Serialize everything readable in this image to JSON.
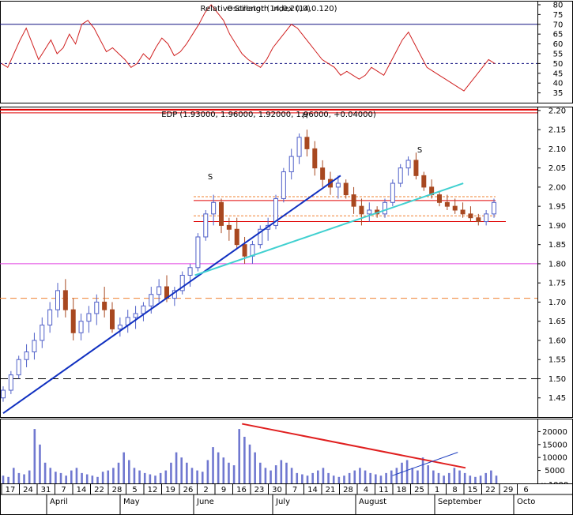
{
  "chart_data": [
    {
      "type": "line",
      "title": "Relative Strength Index (14,0.120)",
      "overlay_title": "Oscillator (14,0,20,0)",
      "yticks": [
        "80",
        "75",
        "70",
        "65",
        "60",
        "55",
        "50",
        "45",
        "40",
        "35"
      ],
      "ylim": [
        30,
        82
      ],
      "reference_lines": [
        70,
        50
      ],
      "series": [
        {
          "values": [
            50,
            48,
            55,
            62,
            68,
            60,
            52,
            57,
            62,
            55,
            58,
            65,
            60,
            70,
            72,
            68,
            62,
            56,
            58,
            55,
            52,
            48,
            50,
            55,
            52,
            58,
            63,
            60,
            54,
            56,
            60,
            65,
            70,
            76,
            80,
            76,
            72,
            65,
            60,
            55,
            52,
            50,
            48,
            52,
            58,
            62,
            66,
            70,
            68,
            64,
            60,
            56,
            52,
            50,
            48,
            44,
            46,
            44,
            42,
            44,
            48,
            46,
            44,
            50,
            56,
            62,
            66,
            60,
            54,
            48,
            46,
            44,
            42,
            40,
            38,
            36,
            40,
            44,
            48,
            52,
            50
          ]
        }
      ]
    },
    {
      "type": "bar",
      "title": "EDP (1.93000, 1.96000, 1.92000, 1.96000, +0.04000)",
      "yticks": [
        "2.20",
        "2.15",
        "2.10",
        "2.05",
        "2.00",
        "1.95",
        "1.90",
        "1.85",
        "1.80",
        "1.75",
        "1.70",
        "1.65",
        "1.60",
        "1.55",
        "1.50",
        "1.45"
      ],
      "ylim": [
        1.4,
        2.21
      ],
      "pattern_labels": [
        "S",
        "H",
        "S"
      ],
      "horizontal_levels": [
        2.2,
        1.8,
        1.71,
        1.5,
        1.975,
        1.965,
        1.925,
        1.91
      ],
      "trendlines": [
        {
          "from": [
            0,
            1.41
          ],
          "to": [
            88,
            2.03
          ]
        },
        {
          "from": [
            50,
            1.77
          ],
          "to": [
            120,
            2.01
          ]
        }
      ],
      "ohlc": [
        [
          1.45,
          1.48,
          1.44,
          1.47
        ],
        [
          1.47,
          1.52,
          1.46,
          1.51
        ],
        [
          1.51,
          1.56,
          1.5,
          1.55
        ],
        [
          1.55,
          1.59,
          1.53,
          1.57
        ],
        [
          1.57,
          1.62,
          1.55,
          1.6
        ],
        [
          1.6,
          1.66,
          1.58,
          1.64
        ],
        [
          1.64,
          1.7,
          1.62,
          1.68
        ],
        [
          1.68,
          1.75,
          1.66,
          1.73
        ],
        [
          1.73,
          1.76,
          1.66,
          1.68
        ],
        [
          1.68,
          1.71,
          1.6,
          1.62
        ],
        [
          1.62,
          1.67,
          1.6,
          1.65
        ],
        [
          1.65,
          1.69,
          1.62,
          1.67
        ],
        [
          1.67,
          1.72,
          1.64,
          1.7
        ],
        [
          1.7,
          1.74,
          1.66,
          1.68
        ],
        [
          1.68,
          1.7,
          1.62,
          1.63
        ],
        [
          1.63,
          1.66,
          1.61,
          1.64
        ],
        [
          1.64,
          1.68,
          1.62,
          1.66
        ],
        [
          1.66,
          1.69,
          1.63,
          1.67
        ],
        [
          1.67,
          1.7,
          1.65,
          1.69
        ],
        [
          1.69,
          1.74,
          1.67,
          1.72
        ],
        [
          1.72,
          1.76,
          1.7,
          1.74
        ],
        [
          1.74,
          1.77,
          1.7,
          1.71
        ],
        [
          1.71,
          1.74,
          1.69,
          1.73
        ],
        [
          1.73,
          1.78,
          1.72,
          1.77
        ],
        [
          1.77,
          1.8,
          1.74,
          1.79
        ],
        [
          1.79,
          1.88,
          1.78,
          1.87
        ],
        [
          1.87,
          1.94,
          1.86,
          1.93
        ],
        [
          1.93,
          1.98,
          1.9,
          1.96
        ],
        [
          1.96,
          1.97,
          1.88,
          1.9
        ],
        [
          1.9,
          1.92,
          1.86,
          1.89
        ],
        [
          1.89,
          1.92,
          1.84,
          1.85
        ],
        [
          1.85,
          1.87,
          1.8,
          1.82
        ],
        [
          1.82,
          1.86,
          1.8,
          1.85
        ],
        [
          1.85,
          1.9,
          1.84,
          1.89
        ],
        [
          1.89,
          1.92,
          1.86,
          1.9
        ],
        [
          1.9,
          1.98,
          1.89,
          1.97
        ],
        [
          1.97,
          2.05,
          1.96,
          2.04
        ],
        [
          2.04,
          2.1,
          2.02,
          2.08
        ],
        [
          2.08,
          2.14,
          2.06,
          2.13
        ],
        [
          2.13,
          2.15,
          2.08,
          2.1
        ],
        [
          2.1,
          2.12,
          2.03,
          2.05
        ],
        [
          2.05,
          2.07,
          2.0,
          2.02
        ],
        [
          2.02,
          2.04,
          1.98,
          2.0
        ],
        [
          2.0,
          2.03,
          1.97,
          2.01
        ],
        [
          2.01,
          2.02,
          1.97,
          1.98
        ],
        [
          1.98,
          2.0,
          1.93,
          1.95
        ],
        [
          1.95,
          1.97,
          1.9,
          1.93
        ],
        [
          1.93,
          1.96,
          1.91,
          1.94
        ],
        [
          1.94,
          1.95,
          1.92,
          1.93
        ],
        [
          1.93,
          1.97,
          1.92,
          1.96
        ],
        [
          1.96,
          2.02,
          1.95,
          2.01
        ],
        [
          2.01,
          2.06,
          2.0,
          2.05
        ],
        [
          2.05,
          2.08,
          2.03,
          2.07
        ],
        [
          2.07,
          2.09,
          2.02,
          2.03
        ],
        [
          2.03,
          2.04,
          1.99,
          2.0
        ],
        [
          2.0,
          2.02,
          1.97,
          1.98
        ],
        [
          1.98,
          1.99,
          1.95,
          1.96
        ],
        [
          1.96,
          1.98,
          1.94,
          1.95
        ],
        [
          1.95,
          1.97,
          1.93,
          1.94
        ],
        [
          1.94,
          1.96,
          1.92,
          1.93
        ],
        [
          1.93,
          1.95,
          1.91,
          1.92
        ],
        [
          1.92,
          1.93,
          1.9,
          1.91
        ],
        [
          1.91,
          1.94,
          1.9,
          1.93
        ],
        [
          1.93,
          1.97,
          1.92,
          1.96
        ]
      ]
    },
    {
      "type": "bar",
      "title": "",
      "yticks": [
        "20000",
        "15000",
        "10000",
        "5000"
      ],
      "scale_label": "x 1000",
      "ylim": [
        0,
        25000
      ],
      "values": [
        3000,
        2500,
        6000,
        4000,
        3500,
        5000,
        21000,
        15000,
        8000,
        6000,
        4500,
        4000,
        3000,
        5000,
        6000,
        4000,
        3500,
        3000,
        2500,
        4500,
        5000,
        6000,
        8000,
        12000,
        9000,
        6000,
        5000,
        4000,
        3500,
        3000,
        4000,
        5000,
        8000,
        12000,
        10000,
        8000,
        6000,
        5000,
        4500,
        9000,
        14000,
        12000,
        10000,
        8000,
        7000,
        21000,
        18000,
        15000,
        12000,
        8000,
        6000,
        5000,
        7000,
        9000,
        8000,
        6000,
        4000,
        3500,
        3000,
        4000,
        5000,
        6000,
        4000,
        3000,
        2500,
        3000,
        4000,
        5000,
        6000,
        5000,
        4000,
        3500,
        3000,
        4000,
        5000,
        6000,
        8000,
        9000,
        6000,
        5000,
        10000,
        7000,
        5000,
        4000,
        3000,
        4000,
        6000,
        5000,
        4000,
        3000,
        2500,
        3000,
        4000,
        5000,
        3000
      ],
      "trendlines": [
        {
          "from": [
            62,
            23000
          ],
          "to": [
            120,
            6000
          ]
        },
        {
          "from": [
            101,
            3000
          ],
          "to": [
            118,
            12000
          ]
        }
      ]
    }
  ],
  "x_axis": {
    "day_ticks": [
      "17",
      "24",
      "31",
      "7",
      "14",
      "22",
      "28",
      "5",
      "12",
      "19",
      "26",
      "2",
      "9",
      "16",
      "23",
      "30",
      "7",
      "14",
      "21",
      "28",
      "4",
      "11",
      "18",
      "25",
      "1",
      "8",
      "15",
      "22",
      "29",
      "6"
    ],
    "month_labels": [
      "April",
      "May",
      "June",
      "July",
      "August",
      "September",
      "Octo"
    ]
  },
  "colors": {
    "up_candle": "#5060c8",
    "down_candle": "#a84820",
    "rsi_line": "#d02020",
    "trendline_primary": "#1030c0",
    "trendline_secondary": "#40d0d0",
    "volume_bar": "#7078d0",
    "resistance_level": "#e00000",
    "support_level_magenta": "#e040e0",
    "dashed_level_orange": "#f08030",
    "volume_trend_red": "#e02020",
    "volume_trend_blue": "#2040c0"
  }
}
